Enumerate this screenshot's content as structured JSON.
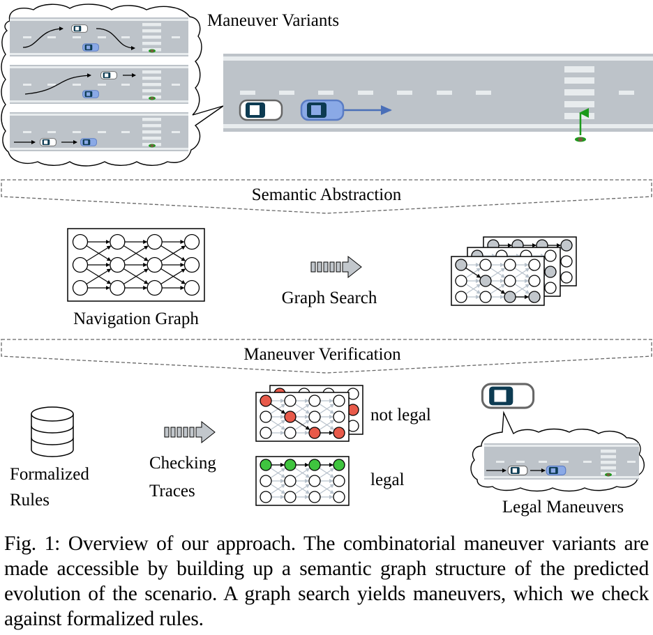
{
  "figure": {
    "maneuver_variants_title": "Maneuver Variants",
    "section_semantic_abstraction": "Semantic Abstraction",
    "section_maneuver_verification": "Maneuver Verification",
    "navigation_graph_label": "Navigation Graph",
    "graph_search_label": "Graph Search",
    "formalized_rules_line1": "Formalized",
    "formalized_rules_line2": "Rules",
    "checking_traces_line1": "Checking",
    "checking_traces_line2": "Traces",
    "not_legal_label": "not legal",
    "legal_label": "legal",
    "legal_maneuvers_label": "Legal Maneuvers",
    "colors": {
      "road": "#bdc3c9",
      "road_marking": "#e8ecee",
      "ego_car": "#ffffff",
      "other_car": "#8aa9e6",
      "car_window": "#0d3b52",
      "ego_arrow": "#4a6fb8",
      "pedestrian_arrow": "#1b9a1b",
      "search_node": "#c2c7cc",
      "illegal_node": "#e85a4a",
      "legal_node": "#3fc43f"
    }
  },
  "caption": {
    "text": "Fig. 1: Overview of our approach. The combinatorial maneuver variants are made accessible by building up a semantic graph structure of the predicted evolution of the scenario. A graph search yields maneuvers, which we check against formalized rules."
  }
}
